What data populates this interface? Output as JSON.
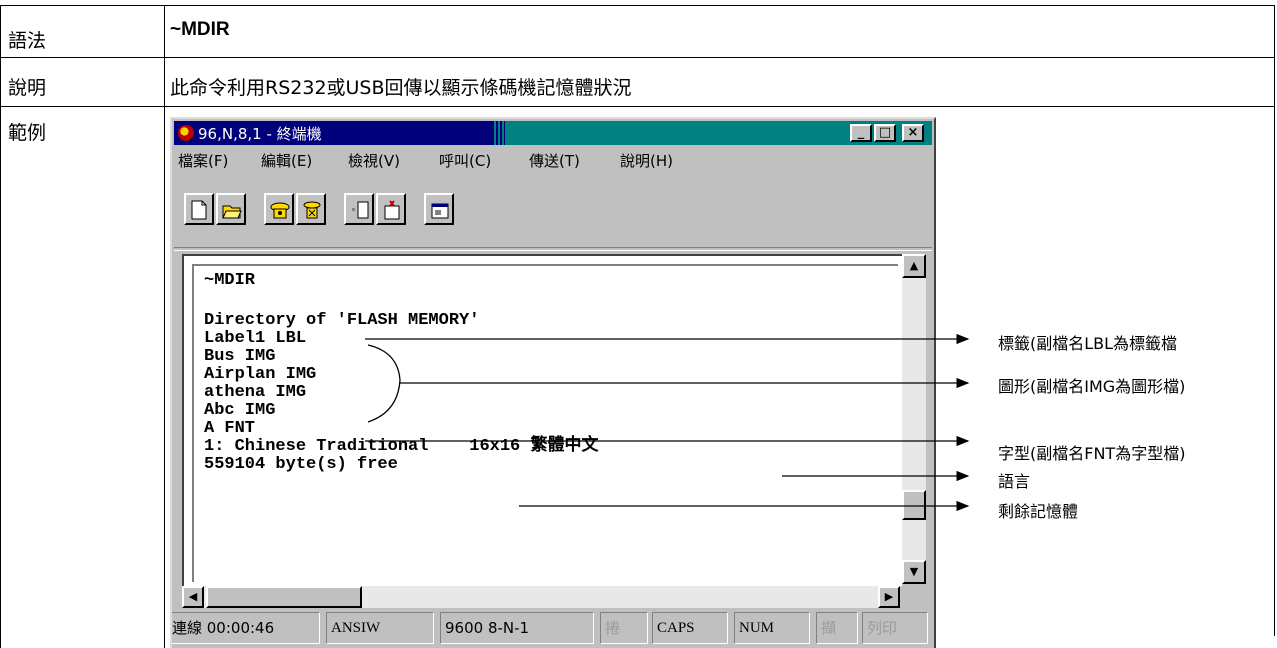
{
  "table": {
    "syntax_label": "語法",
    "syntax_value": "~MDIR",
    "desc_label": "說明",
    "desc_value": "此命令利用RS232或USB回傳以顯示條碼機記憶體狀況",
    "example_label": "範例"
  },
  "window": {
    "title": "96,N,8,1 - 終端機",
    "min_label": "_",
    "max_label": "□",
    "close_label": "×",
    "menus": [
      "檔案(F)",
      "編輯(E)",
      "檢視(V)",
      "呼叫(C)",
      "傳送(T)",
      "說明(H)"
    ]
  },
  "terminal": {
    "lines": [
      "~MDIR",
      "",
      "Directory of 'FLASH MEMORY'",
      "Label1 LBL",
      "Bus IMG",
      "Airplan IMG",
      "athena IMG",
      "Abc IMG",
      "A FNT",
      "1: Chinese Traditional    16x16 繁體中文",
      "559104 byte(s) free"
    ]
  },
  "statusbar": {
    "connect": "連線 00:00:46",
    "emulation": "ANSIW",
    "port": "9600 8-N-1",
    "scroll": "捲",
    "caps": "CAPS",
    "num": "NUM",
    "capture": "擷",
    "print": "列印"
  },
  "annotations": {
    "label": "標籤(副檔名LBL為標籤檔",
    "image": "圖形(副檔名IMG為圖形檔)",
    "font": "字型(副檔名FNT為字型檔)",
    "language": "語言",
    "free": "剩餘記憶體"
  }
}
